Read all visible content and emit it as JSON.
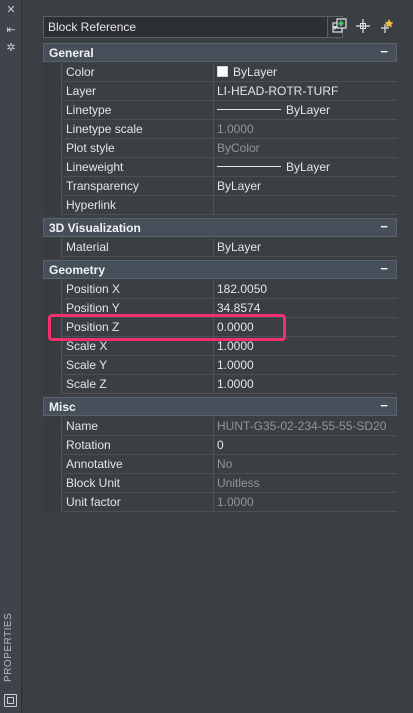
{
  "sidebar": {
    "vertical_label": "PROPERTIES",
    "icons": [
      "close-icon",
      "auto-hide-icon",
      "settings-icon",
      "options-icon"
    ]
  },
  "toolbar": {
    "object_type": "Block Reference",
    "buttons": [
      "toggle-pickadd-icon",
      "select-objects-icon",
      "quick-select-icon"
    ]
  },
  "sections": {
    "general": {
      "title": "General",
      "toggle": "−",
      "rows": [
        {
          "label": "Color",
          "value": "ByLayer"
        },
        {
          "label": "Layer",
          "value": "LI-HEAD-ROTR-TURF"
        },
        {
          "label": "Linetype",
          "value": "ByLayer"
        },
        {
          "label": "Linetype scale",
          "value": "1.0000"
        },
        {
          "label": "Plot style",
          "value": "ByColor"
        },
        {
          "label": "Lineweight",
          "value": "ByLayer"
        },
        {
          "label": "Transparency",
          "value": "ByLayer"
        },
        {
          "label": "Hyperlink",
          "value": ""
        }
      ]
    },
    "viz": {
      "title": "3D Visualization",
      "toggle": "−",
      "rows": [
        {
          "label": "Material",
          "value": "ByLayer"
        }
      ]
    },
    "geometry": {
      "title": "Geometry",
      "toggle": "−",
      "rows": [
        {
          "label": "Position X",
          "value": "182.0050"
        },
        {
          "label": "Position Y",
          "value": "34.8574"
        },
        {
          "label": "Position Z",
          "value": "0.0000"
        },
        {
          "label": "Scale X",
          "value": "1.0000"
        },
        {
          "label": "Scale Y",
          "value": "1.0000"
        },
        {
          "label": "Scale Z",
          "value": "1.0000"
        }
      ]
    },
    "misc": {
      "title": "Misc",
      "toggle": "−",
      "rows": [
        {
          "label": "Name",
          "value": "HUNT-G35-02-234-55-55-SD20"
        },
        {
          "label": "Rotation",
          "value": "0"
        },
        {
          "label": "Annotative",
          "value": "No"
        },
        {
          "label": "Block Unit",
          "value": "Unitless"
        },
        {
          "label": "Unit factor",
          "value": "1.0000"
        }
      ]
    }
  },
  "colors": {
    "highlight": "#f3306d",
    "background": "#3b3f44",
    "section_header": "#47505a"
  }
}
